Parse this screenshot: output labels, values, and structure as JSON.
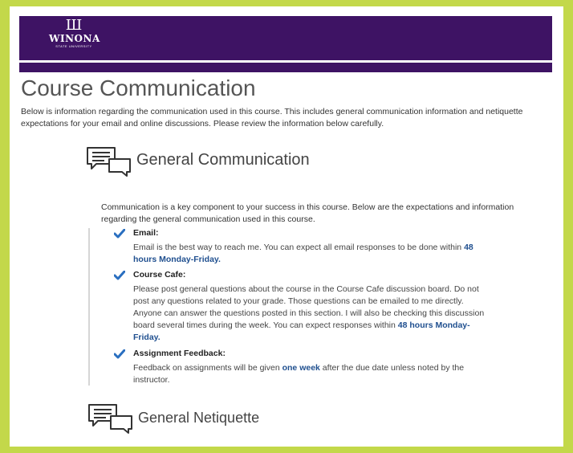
{
  "header": {
    "logo_mark": "Ш",
    "logo_name": "WINONA",
    "logo_sub": "STATE UNIVERSITY"
  },
  "page": {
    "title": "Course Communication",
    "intro": "Below is information regarding the communication used in this course. This includes general communication information and netiquette expectations for your email and online discussions. Please review the information below carefully."
  },
  "general_communication": {
    "heading": "General Communication",
    "lead": "Communication is a key component to your success in this course. Below are the expectations and information regarding the general communication used in this course.",
    "items": [
      {
        "title": "Email:",
        "text_before": "Email is the best way to reach me. You can expect all email responses to be done within ",
        "highlight": "48 hours Monday-Friday.",
        "text_after": ""
      },
      {
        "title": "Course Cafe:",
        "text_before": "Please post general questions about the course in the Course Cafe discussion board. Do not post any questions related to your grade. Those questions can be emailed to me directly. Anyone can answer the questions posted in this section. I will also be checking this discussion board several times during the week. You can expect responses within ",
        "highlight": "48 hours Monday-Friday.",
        "text_after": ""
      },
      {
        "title": "Assignment Feedback:",
        "text_before": "Feedback on assignments will be given ",
        "highlight": "one week",
        "text_after": " after the due date unless noted by the instructor."
      }
    ]
  },
  "general_netiquette": {
    "heading": "General Netiquette"
  },
  "icons": {
    "section_icon": "speech-bubbles-icon",
    "check_icon": "checkmark-icon"
  },
  "colors": {
    "banner": "#3e1364",
    "page_border": "#c3d84a",
    "highlight": "#1f4f8f",
    "check": "#2a6fc0"
  }
}
